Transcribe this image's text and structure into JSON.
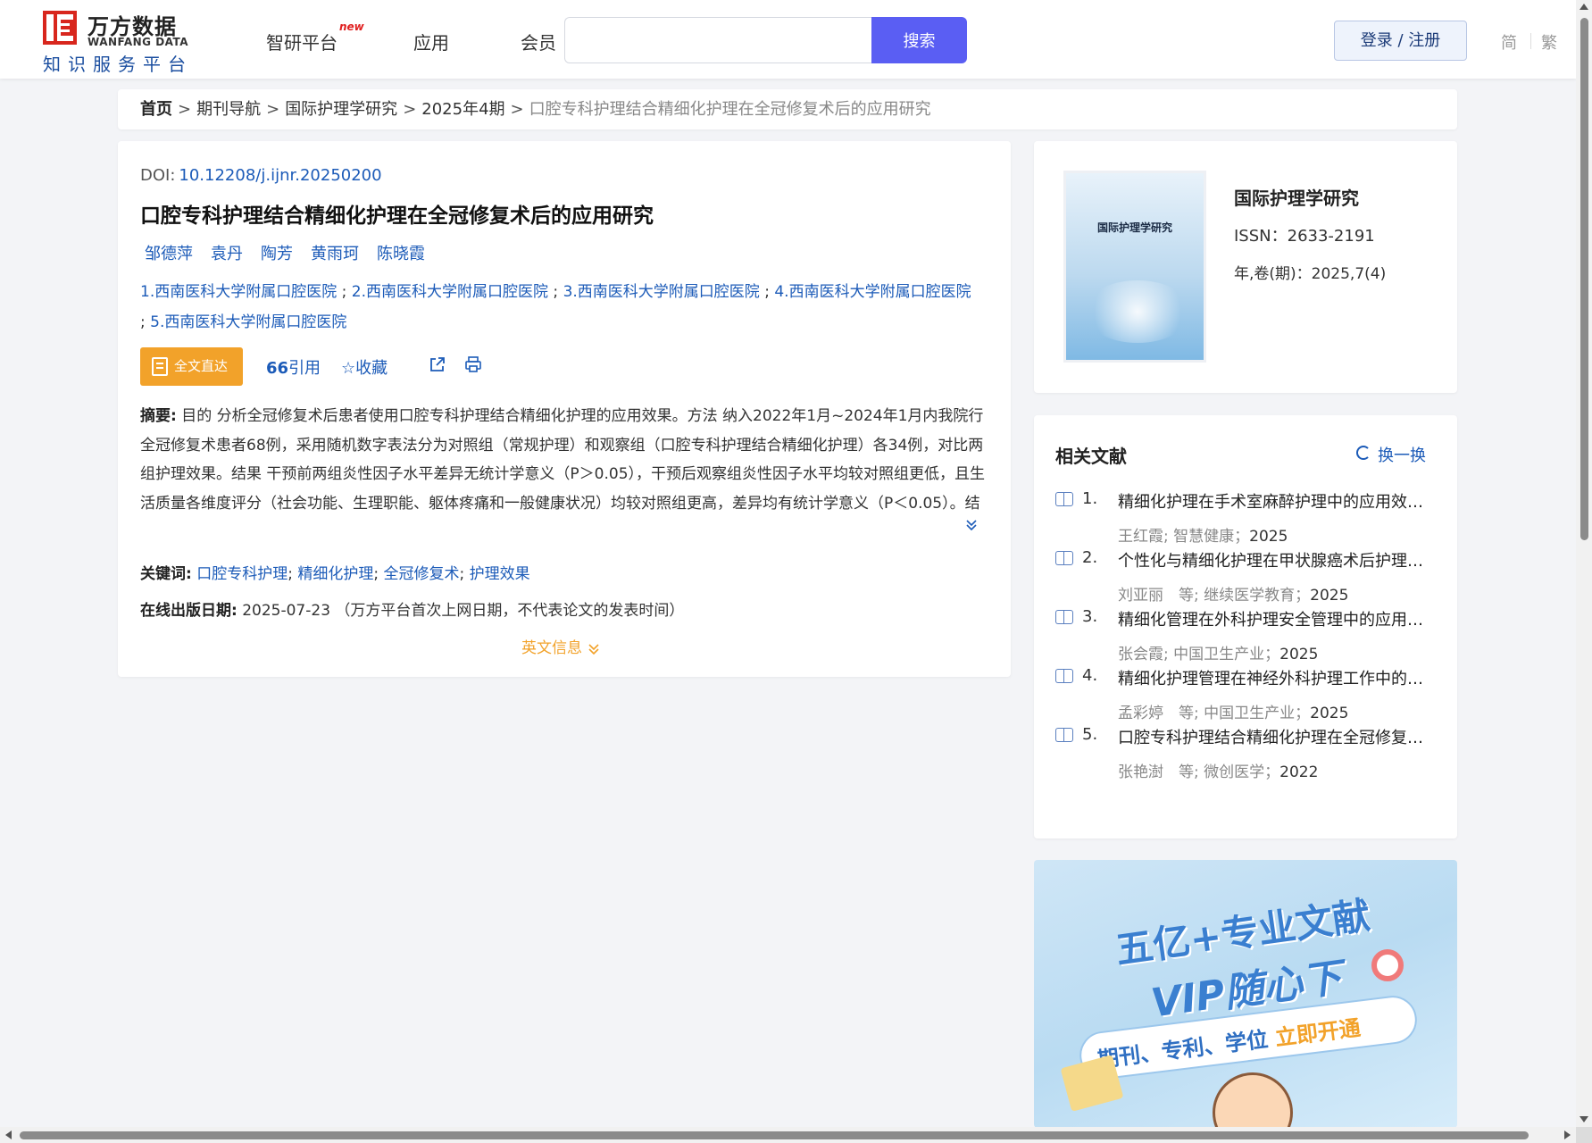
{
  "header": {
    "logo_cn": "万方数据",
    "logo_en": "WANFANG DATA",
    "logo_sub": "知识服务平台",
    "nav": [
      {
        "label": "智研平台",
        "badge": "new"
      },
      {
        "label": "应用"
      },
      {
        "label": "会员"
      }
    ],
    "search": {
      "placeholder": "",
      "button": "搜索"
    },
    "login": "登录 / 注册",
    "lang": [
      "简",
      "繁"
    ]
  },
  "breadcrumb": {
    "items": [
      "首页",
      "期刊导航",
      "国际护理学研究",
      "2025年4期"
    ],
    "current": "口腔专科护理结合精细化护理在全冠修复术后的应用研究",
    "separator": ">"
  },
  "article": {
    "doi_label": "DOI:",
    "doi": "10.12208/j.ijnr.20250200",
    "title": "口腔专科护理结合精细化护理在全冠修复术后的应用研究",
    "authors": [
      "邹德萍",
      "袁丹",
      "陶芳",
      "黄雨珂",
      "陈晓霞"
    ],
    "orgs": [
      "1.西南医科大学附属口腔医院",
      "2.西南医科大学附属口腔医院",
      "3.西南医科大学附属口腔医院",
      "4.西南医科大学附属口腔医院",
      "5.西南医科大学附属口腔医院"
    ],
    "org_sep": ";",
    "actions": {
      "fulltext": "全文直达",
      "cite": "引用",
      "collect": "收藏"
    },
    "abstract_label": "摘要:",
    "abstract": "目的 分析全冠修复术后患者使用口腔专科护理结合精细化护理的应用效果。方法 纳入2022年1月~2024年1月内我院行全冠修复术患者68例，采用随机数字表法分为对照组（常规护理）和观察组（口腔专科护理结合精细化护理）各34例，对比两组护理效果。结果 干预前两组炎性因子水平差异无统计学意义（P＞0.05），干预后观察组炎性因子水平均较对照组更低，且生活质量各维度评分（社会功能、生理职能、躯体疼痛和一般健康状况）均较对照组更高，差异均有统计学意义（P＜0.05）。结论 临床中对全冠修复术后患者实施口腔专科护理结合精细化护理能够显著降低患者炎性因子水平，提...",
    "keywords_label": "关键词:",
    "keywords": [
      "口腔专科护理",
      "精细化护理",
      "全冠修复术",
      "护理效果"
    ],
    "kw_sep": ";",
    "pubdate_label": "在线出版日期:",
    "pubdate": "2025-07-23",
    "pubdate_note": "（万方平台首次上网日期，不代表论文的发表时间）",
    "english_info": "英文信息"
  },
  "journal": {
    "cover_title": "国际护理学研究",
    "name": "国际护理学研究",
    "issn": "ISSN：2633-2191",
    "year_issue": "年,卷(期)：2025,7(4)"
  },
  "related": {
    "title": "相关文献",
    "refresh": "换一换",
    "items": [
      {
        "num": "1.",
        "title": "精细化护理在手术室麻醉护理中的应用效果...",
        "authors": "王红霞; 智慧健康；",
        "year": "2025"
      },
      {
        "num": "2.",
        "title": "个性化与精细化护理在甲状腺癌术后护理中...",
        "authors": "刘亚丽　等;  继续医学教育；",
        "year": "2025"
      },
      {
        "num": "3.",
        "title": "精细化管理在外科护理安全管理中的应用及...",
        "authors": "张会霞; 中国卫生产业；",
        "year": "2025"
      },
      {
        "num": "4.",
        "title": "精细化护理管理在神经外科护理工作中的应...",
        "authors": "孟彩婷　等;  中国卫生产业；",
        "year": "2025"
      },
      {
        "num": "5.",
        "title": "口腔专科护理结合精细化护理在全冠修复术...",
        "authors": "张艳澍　等;  微创医学；",
        "year": "2022"
      }
    ]
  },
  "ad": {
    "line1": "五亿+专业文献",
    "line2": "VIP随心下",
    "line3": "期刊、专利、学位",
    "line3_highlight": "立即开通"
  }
}
